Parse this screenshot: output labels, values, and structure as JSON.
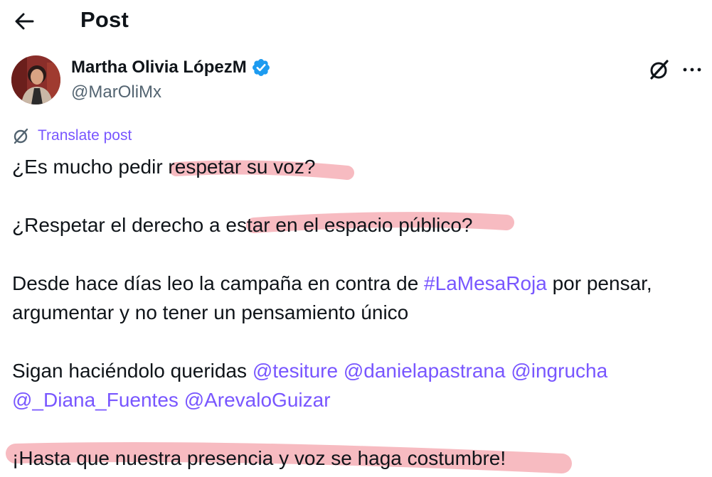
{
  "header": {
    "title": "Post"
  },
  "author": {
    "display_name": "Martha Olivia LópezM",
    "handle": "@MarOliMx"
  },
  "translate_label": "Translate post",
  "tweet": {
    "l1": "¿Es mucho pedir respetar su voz?",
    "l2": "¿Respetar el derecho a estar en el espacio público?",
    "l3_pre": "Desde hace días leo la campaña en contra de ",
    "l3_tag": "#LaMesaRoja",
    "l3_post": " por pensar,",
    "l4": "argumentar y no tener un pensamiento único",
    "l5_pre": "Sigan haciéndolo queridas ",
    "m1": "@tesiture",
    "m2": "@danielapastrana",
    "m3": "@ingrucha",
    "m4": "@_Diana_Fuentes",
    "m5": "@ArevaloGuizar",
    "l7": "¡Hasta que nuestra presencia y voz se haga costumbre!"
  },
  "icons": {
    "back": "arrow-left-icon",
    "verified": "verified-badge-icon",
    "grok": "grok-icon",
    "more": "more-icon",
    "translate": "translate-icon"
  },
  "colors": {
    "link": "#7856ff",
    "verified": "#1d9bf0",
    "highlight": "#f4a4ac"
  }
}
